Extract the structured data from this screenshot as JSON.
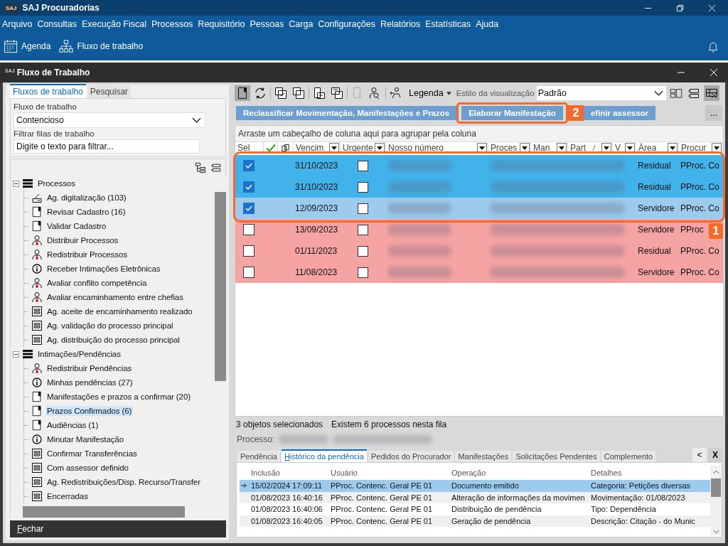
{
  "app": {
    "logo": "SAJ",
    "title": "SAJ Procuradorias"
  },
  "menu": [
    "Arquivo",
    "Consultas",
    "Execução Fiscal",
    "Processos",
    "Requisitório",
    "Pessoas",
    "Carga",
    "Configurações",
    "Relatórios",
    "Estatísticas",
    "Ajuda"
  ],
  "toolbar": [
    {
      "kind": "calendar",
      "label": "Agenda"
    },
    {
      "kind": "hierarchy",
      "label": "Fluxo de trabalho"
    }
  ],
  "window": {
    "logo": "SAJ",
    "title": "Fluxo de Trabalho"
  },
  "left_tabs": [
    {
      "label": "Fluxos de trabalho",
      "selected": true
    },
    {
      "label": "Pesquisar",
      "selected": false
    }
  ],
  "workflow": {
    "label": "Fluxo de trabalho",
    "value": "Contencioso",
    "filter_label": "Filtrar filas de trabalho",
    "filter_placeholder": "Digite o texto para filtrar..."
  },
  "tree": [
    {
      "label": "Processos",
      "expanded": true,
      "selected": false,
      "children": [
        {
          "kind": "scanner",
          "label": "Ag. digitalização (103)",
          "selected": false
        },
        {
          "kind": "flag",
          "label": "Revisar Cadastro (16)",
          "selected": false
        },
        {
          "kind": "flag",
          "label": "Validar Cadastro",
          "selected": false
        },
        {
          "kind": "person",
          "label": "Distribuir Processos",
          "selected": false
        },
        {
          "kind": "person",
          "label": "Redistribuir Processos",
          "selected": false
        },
        {
          "kind": "info",
          "label": "Receber Intimações Eletrônicas",
          "selected": false
        },
        {
          "kind": "person",
          "label": "Avaliar conflito competência",
          "selected": false
        },
        {
          "kind": "person",
          "label": "Avaliar encaminhamento entre chefias",
          "selected": false
        },
        {
          "kind": "form",
          "label": "Ag. aceite de encaminhamento realizado",
          "selected": false
        },
        {
          "kind": "form",
          "label": "Ag. validação do processo principal",
          "selected": false
        },
        {
          "kind": "form",
          "label": "Ag. distribuição do processo principal",
          "selected": false
        }
      ]
    },
    {
      "label": "Intimações/Pendências",
      "expanded": true,
      "selected": false,
      "children": [
        {
          "kind": "person",
          "label": "Redistribuir Pendências",
          "selected": false
        },
        {
          "kind": "info",
          "label": "Minhas pendências (27)",
          "selected": false
        },
        {
          "kind": "flag",
          "label": "Manifestações e prazos a confirmar (20)",
          "selected": false
        },
        {
          "kind": "flag",
          "label": "Prazos Confirmados (6)",
          "selected": true
        },
        {
          "kind": "flag",
          "label": "Audiências (1)",
          "selected": false
        },
        {
          "kind": "info",
          "label": "Minutar Manifestação",
          "selected": false
        },
        {
          "kind": "form",
          "label": "Confirmar Transferências",
          "selected": false
        },
        {
          "kind": "form",
          "label": "Com assessor definido",
          "selected": false
        },
        {
          "kind": "form",
          "label": "Ag. Redistribuições/Disp. Recurso/Transfer",
          "selected": false
        },
        {
          "kind": "form",
          "label": "Encerradas",
          "selected": false
        }
      ]
    }
  ],
  "close_button": "Fechar",
  "view": {
    "legend": "Legenda",
    "style_label": "Estilo da visualização",
    "style_value": "Padrão"
  },
  "actions": [
    {
      "label": "Reclassificar Movimentação, Manifestações e Prazos"
    },
    {
      "label": "Elaborar Manifestação",
      "callout": "2"
    },
    {
      "label": "efinir assessor"
    }
  ],
  "more_button": "...",
  "group_hint": "Arraste um cabeçalho de coluna aqui para agrupar pela coluna",
  "columns": [
    "Sel",
    "Vencim",
    "Urgente",
    "Nosso número",
    "Proces",
    "Man",
    "Part",
    "V",
    "Área",
    "Procur"
  ],
  "rows_callout": "1",
  "rows": [
    {
      "selected": true,
      "focused": false,
      "checked": true,
      "due": "31/10/2023",
      "urgent": false,
      "area": "Residual",
      "procurador": "PProc. Co"
    },
    {
      "selected": true,
      "focused": false,
      "checked": true,
      "due": "31/10/2023",
      "urgent": false,
      "area": "Residual",
      "procurador": "PProc. Co"
    },
    {
      "selected": true,
      "focused": true,
      "checked": true,
      "due": "12/09/2023",
      "urgent": false,
      "area": "Servidore",
      "procurador": "PProc. Co"
    },
    {
      "selected": false,
      "focused": false,
      "checked": false,
      "due": "13/09/2023",
      "urgent": false,
      "area": "Servidore",
      "procurador": "PProc"
    },
    {
      "selected": false,
      "focused": false,
      "checked": false,
      "due": "01/11/2023",
      "urgent": false,
      "area": "Residual",
      "procurador": "PProc. Co"
    },
    {
      "selected": false,
      "focused": false,
      "checked": false,
      "due": "11/08/2023",
      "urgent": false,
      "area": "Servidore",
      "procurador": "PProc. Co"
    }
  ],
  "status": {
    "selected_count": "3 objetos selecionados",
    "queue_count": "Existem 6 processos nesta fila",
    "process_label": "Processo:"
  },
  "detail_tabs": [
    {
      "label": "Pendência",
      "selected": false
    },
    {
      "label": "Histórico da pendência",
      "selected": true
    },
    {
      "label": "Pedidos do Procurador",
      "selected": false
    },
    {
      "label": "Manifestações",
      "selected": false
    },
    {
      "label": "Solicitações Pendentes",
      "selected": false
    },
    {
      "label": "Complemento",
      "selected": false
    }
  ],
  "detail_nav": "<",
  "detail_close": "X",
  "history": {
    "columns": [
      "Inclusão",
      "Usuário",
      "Operação",
      "Detalhes"
    ],
    "rows": [
      {
        "selected": true,
        "cells": [
          "15/02/2024 17:09:11",
          "PProc. Contenc. Geral PE 01",
          "Documento emitido",
          "Categoria: Petições diversas"
        ]
      },
      {
        "selected": false,
        "cells": [
          "01/08/2023 16:40:16",
          "PProc. Contenc. Geral PE 01",
          "Alteração de informações da movimen",
          "Movimentação: 01/08/2023"
        ]
      },
      {
        "selected": false,
        "cells": [
          "01/08/2023 16:40:06",
          "PProc. Contenc. Geral PE 01",
          "Distribuição de pendência",
          "Tipo: Dependência"
        ]
      },
      {
        "selected": false,
        "cells": [
          "01/08/2023 16:40:05",
          "PProc. Contenc. Geral PE 01",
          "Geração de pendência",
          "Descrição: Citação - do Munic"
        ]
      }
    ]
  }
}
